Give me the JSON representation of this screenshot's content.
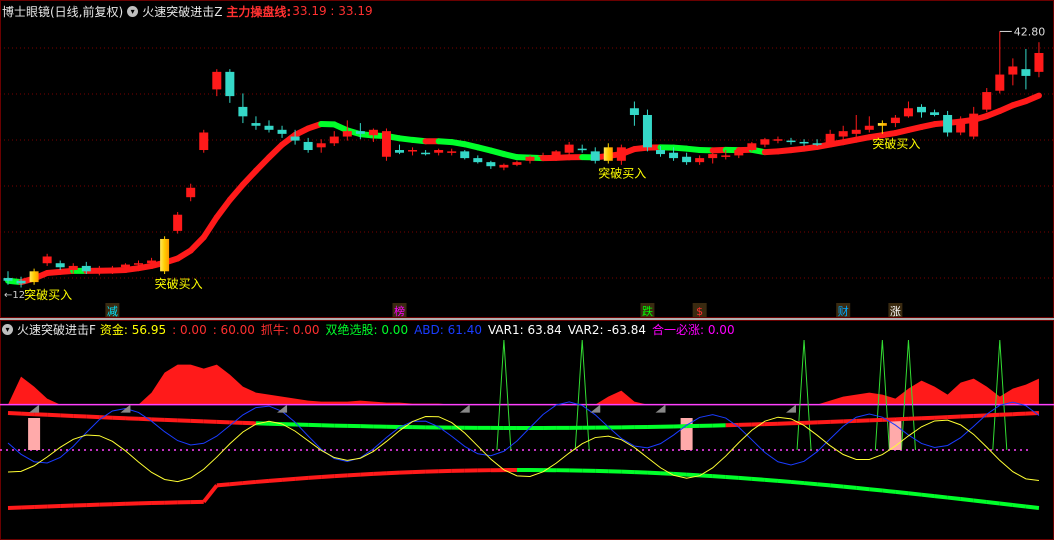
{
  "main_panel": {
    "title": "博士眼镜(日线,前复权)",
    "indicator_name": "火速突破进击Z",
    "line_label": "主力操盘线:",
    "line_values": "33.19 : 33.19",
    "price_max_label": "42.80",
    "left_edge_label": "←12",
    "buy_signal_label": "突破买入",
    "buy_signals": [
      {
        "idx": 2
      },
      {
        "idx": 12
      },
      {
        "idx": 46
      },
      {
        "idx": 67
      }
    ],
    "event_markers": [
      {
        "idx": 8,
        "text": "减",
        "color": "#00e5ff"
      },
      {
        "idx": 30,
        "text": "榜",
        "color": "#ff00ff"
      },
      {
        "idx": 49,
        "text": "跌",
        "color": "#00ff00"
      },
      {
        "idx": 53,
        "text": "$",
        "color": "#ff3030"
      },
      {
        "idx": 64,
        "text": "财",
        "color": "#00a8ff"
      },
      {
        "idx": 68,
        "text": "涨",
        "color": "#ffffff"
      }
    ],
    "candles": [
      [
        24.5,
        25.0,
        24.0,
        24.3
      ],
      [
        24.3,
        24.6,
        23.8,
        24.1
      ],
      [
        24.2,
        25.2,
        24.0,
        25.0
      ],
      [
        25.6,
        26.3,
        25.4,
        26.1
      ],
      [
        25.6,
        25.8,
        25.1,
        25.3
      ],
      [
        25.1,
        25.6,
        24.8,
        25.4
      ],
      [
        25.4,
        25.7,
        24.8,
        25.0
      ],
      [
        25.0,
        25.4,
        24.7,
        25.1
      ],
      [
        25.1,
        25.4,
        24.8,
        25.2
      ],
      [
        25.3,
        25.6,
        25.0,
        25.5
      ],
      [
        25.5,
        25.8,
        25.3,
        25.6
      ],
      [
        25.6,
        26.0,
        25.4,
        25.8
      ],
      [
        25.0,
        27.6,
        24.8,
        27.4
      ],
      [
        28.0,
        29.4,
        27.8,
        29.2
      ],
      [
        30.5,
        31.5,
        30.2,
        31.2
      ],
      [
        34.0,
        35.5,
        33.8,
        35.3
      ],
      [
        38.5,
        40.0,
        38.0,
        39.8
      ],
      [
        39.8,
        40.0,
        37.5,
        38.0
      ],
      [
        37.2,
        38.2,
        36.0,
        36.5
      ],
      [
        36.0,
        36.5,
        35.5,
        35.8
      ],
      [
        35.8,
        36.2,
        35.3,
        35.5
      ],
      [
        35.5,
        35.8,
        34.9,
        35.2
      ],
      [
        35.0,
        35.5,
        34.4,
        34.7
      ],
      [
        34.6,
        34.9,
        33.8,
        34.0
      ],
      [
        34.2,
        34.8,
        33.8,
        34.5
      ],
      [
        34.5,
        35.4,
        34.3,
        35.0
      ],
      [
        35.0,
        36.2,
        34.7,
        35.4
      ],
      [
        35.4,
        36.0,
        34.8,
        35.2
      ],
      [
        35.1,
        35.6,
        34.6,
        35.5
      ],
      [
        33.5,
        35.6,
        33.2,
        35.4
      ],
      [
        34.0,
        34.4,
        33.7,
        33.8
      ],
      [
        33.9,
        34.2,
        33.6,
        34.0
      ],
      [
        33.8,
        34.0,
        33.6,
        33.7
      ],
      [
        33.8,
        34.1,
        33.6,
        34.0
      ],
      [
        33.8,
        34.1,
        33.6,
        33.9
      ],
      [
        33.9,
        34.0,
        33.3,
        33.4
      ],
      [
        33.4,
        33.6,
        33.0,
        33.1
      ],
      [
        33.1,
        33.2,
        32.6,
        32.8
      ],
      [
        32.7,
        33.0,
        32.5,
        32.9
      ],
      [
        32.9,
        33.2,
        32.8,
        33.1
      ],
      [
        33.2,
        33.6,
        33.0,
        33.5
      ],
      [
        33.5,
        33.8,
        33.2,
        33.6
      ],
      [
        33.6,
        34.0,
        33.3,
        33.9
      ],
      [
        33.8,
        34.6,
        33.5,
        34.4
      ],
      [
        34.1,
        34.4,
        33.8,
        34.0
      ],
      [
        33.9,
        34.2,
        33.0,
        33.2
      ],
      [
        33.2,
        34.5,
        33.0,
        34.2
      ],
      [
        33.2,
        34.4,
        32.9,
        34.2
      ],
      [
        37.1,
        37.6,
        35.8,
        36.6
      ],
      [
        36.6,
        37.0,
        33.9,
        34.2
      ],
      [
        34.0,
        34.3,
        33.5,
        33.7
      ],
      [
        33.8,
        34.2,
        33.2,
        33.4
      ],
      [
        33.5,
        33.8,
        32.9,
        33.1
      ],
      [
        33.1,
        33.6,
        32.9,
        33.4
      ],
      [
        33.4,
        33.8,
        33.0,
        33.7
      ],
      [
        33.5,
        34.0,
        33.3,
        33.6
      ],
      [
        33.6,
        34.2,
        33.4,
        34.0
      ],
      [
        34.0,
        34.6,
        33.9,
        34.5
      ],
      [
        34.4,
        34.9,
        34.2,
        34.8
      ],
      [
        34.7,
        35.0,
        34.5,
        34.8
      ],
      [
        34.7,
        34.9,
        34.4,
        34.6
      ],
      [
        34.6,
        34.8,
        34.3,
        34.5
      ],
      [
        34.5,
        34.8,
        34.3,
        34.4
      ],
      [
        34.3,
        35.5,
        34.2,
        35.2
      ],
      [
        35.0,
        35.8,
        34.8,
        35.4
      ],
      [
        35.2,
        36.6,
        35.0,
        35.5
      ],
      [
        35.5,
        36.5,
        35.3,
        35.8
      ],
      [
        35.8,
        36.2,
        35.2,
        36.0
      ],
      [
        36.0,
        36.6,
        35.7,
        36.4
      ],
      [
        36.5,
        37.6,
        36.4,
        37.1
      ],
      [
        37.2,
        37.4,
        36.4,
        36.8
      ],
      [
        36.8,
        37.0,
        36.5,
        36.6
      ],
      [
        36.6,
        36.9,
        35.0,
        35.3
      ],
      [
        35.3,
        36.5,
        35.1,
        36.2
      ],
      [
        35.0,
        37.2,
        34.8,
        36.7
      ],
      [
        37.0,
        38.6,
        36.8,
        38.3
      ],
      [
        38.4,
        42.8,
        38.2,
        39.6
      ],
      [
        39.6,
        40.8,
        38.8,
        40.2
      ],
      [
        40.0,
        41.5,
        38.5,
        39.5
      ],
      [
        39.8,
        42.0,
        39.4,
        41.2
      ]
    ],
    "ma_colors": {
      "up": "#ff1a1a",
      "down": "#00ff2a"
    }
  },
  "sub_panel": {
    "indicator_name": "火速突破进击F",
    "fields": [
      {
        "label": "资金:",
        "value": "56.95",
        "color": "#ffff00"
      },
      {
        "label": "",
        "value": ": 0.00",
        "color": "#ff3030"
      },
      {
        "label": "",
        "value": ": 60.00",
        "color": "#ff3030"
      },
      {
        "label": "抓牛:",
        "value": "0.00",
        "color": "#ff3030"
      },
      {
        "label": "双绝选股:",
        "value": "0.00",
        "color": "#00ff2a"
      },
      {
        "label": "ABD:",
        "value": "61.40",
        "color": "#1a3cff"
      },
      {
        "label": "VAR1:",
        "value": "63.84",
        "color": "#ffffff"
      },
      {
        "label": "VAR2:",
        "value": "-63.84",
        "color": "#ffffff"
      },
      {
        "label": "合一必涨:",
        "value": "0.00",
        "color": "#ff00ff"
      }
    ]
  }
}
